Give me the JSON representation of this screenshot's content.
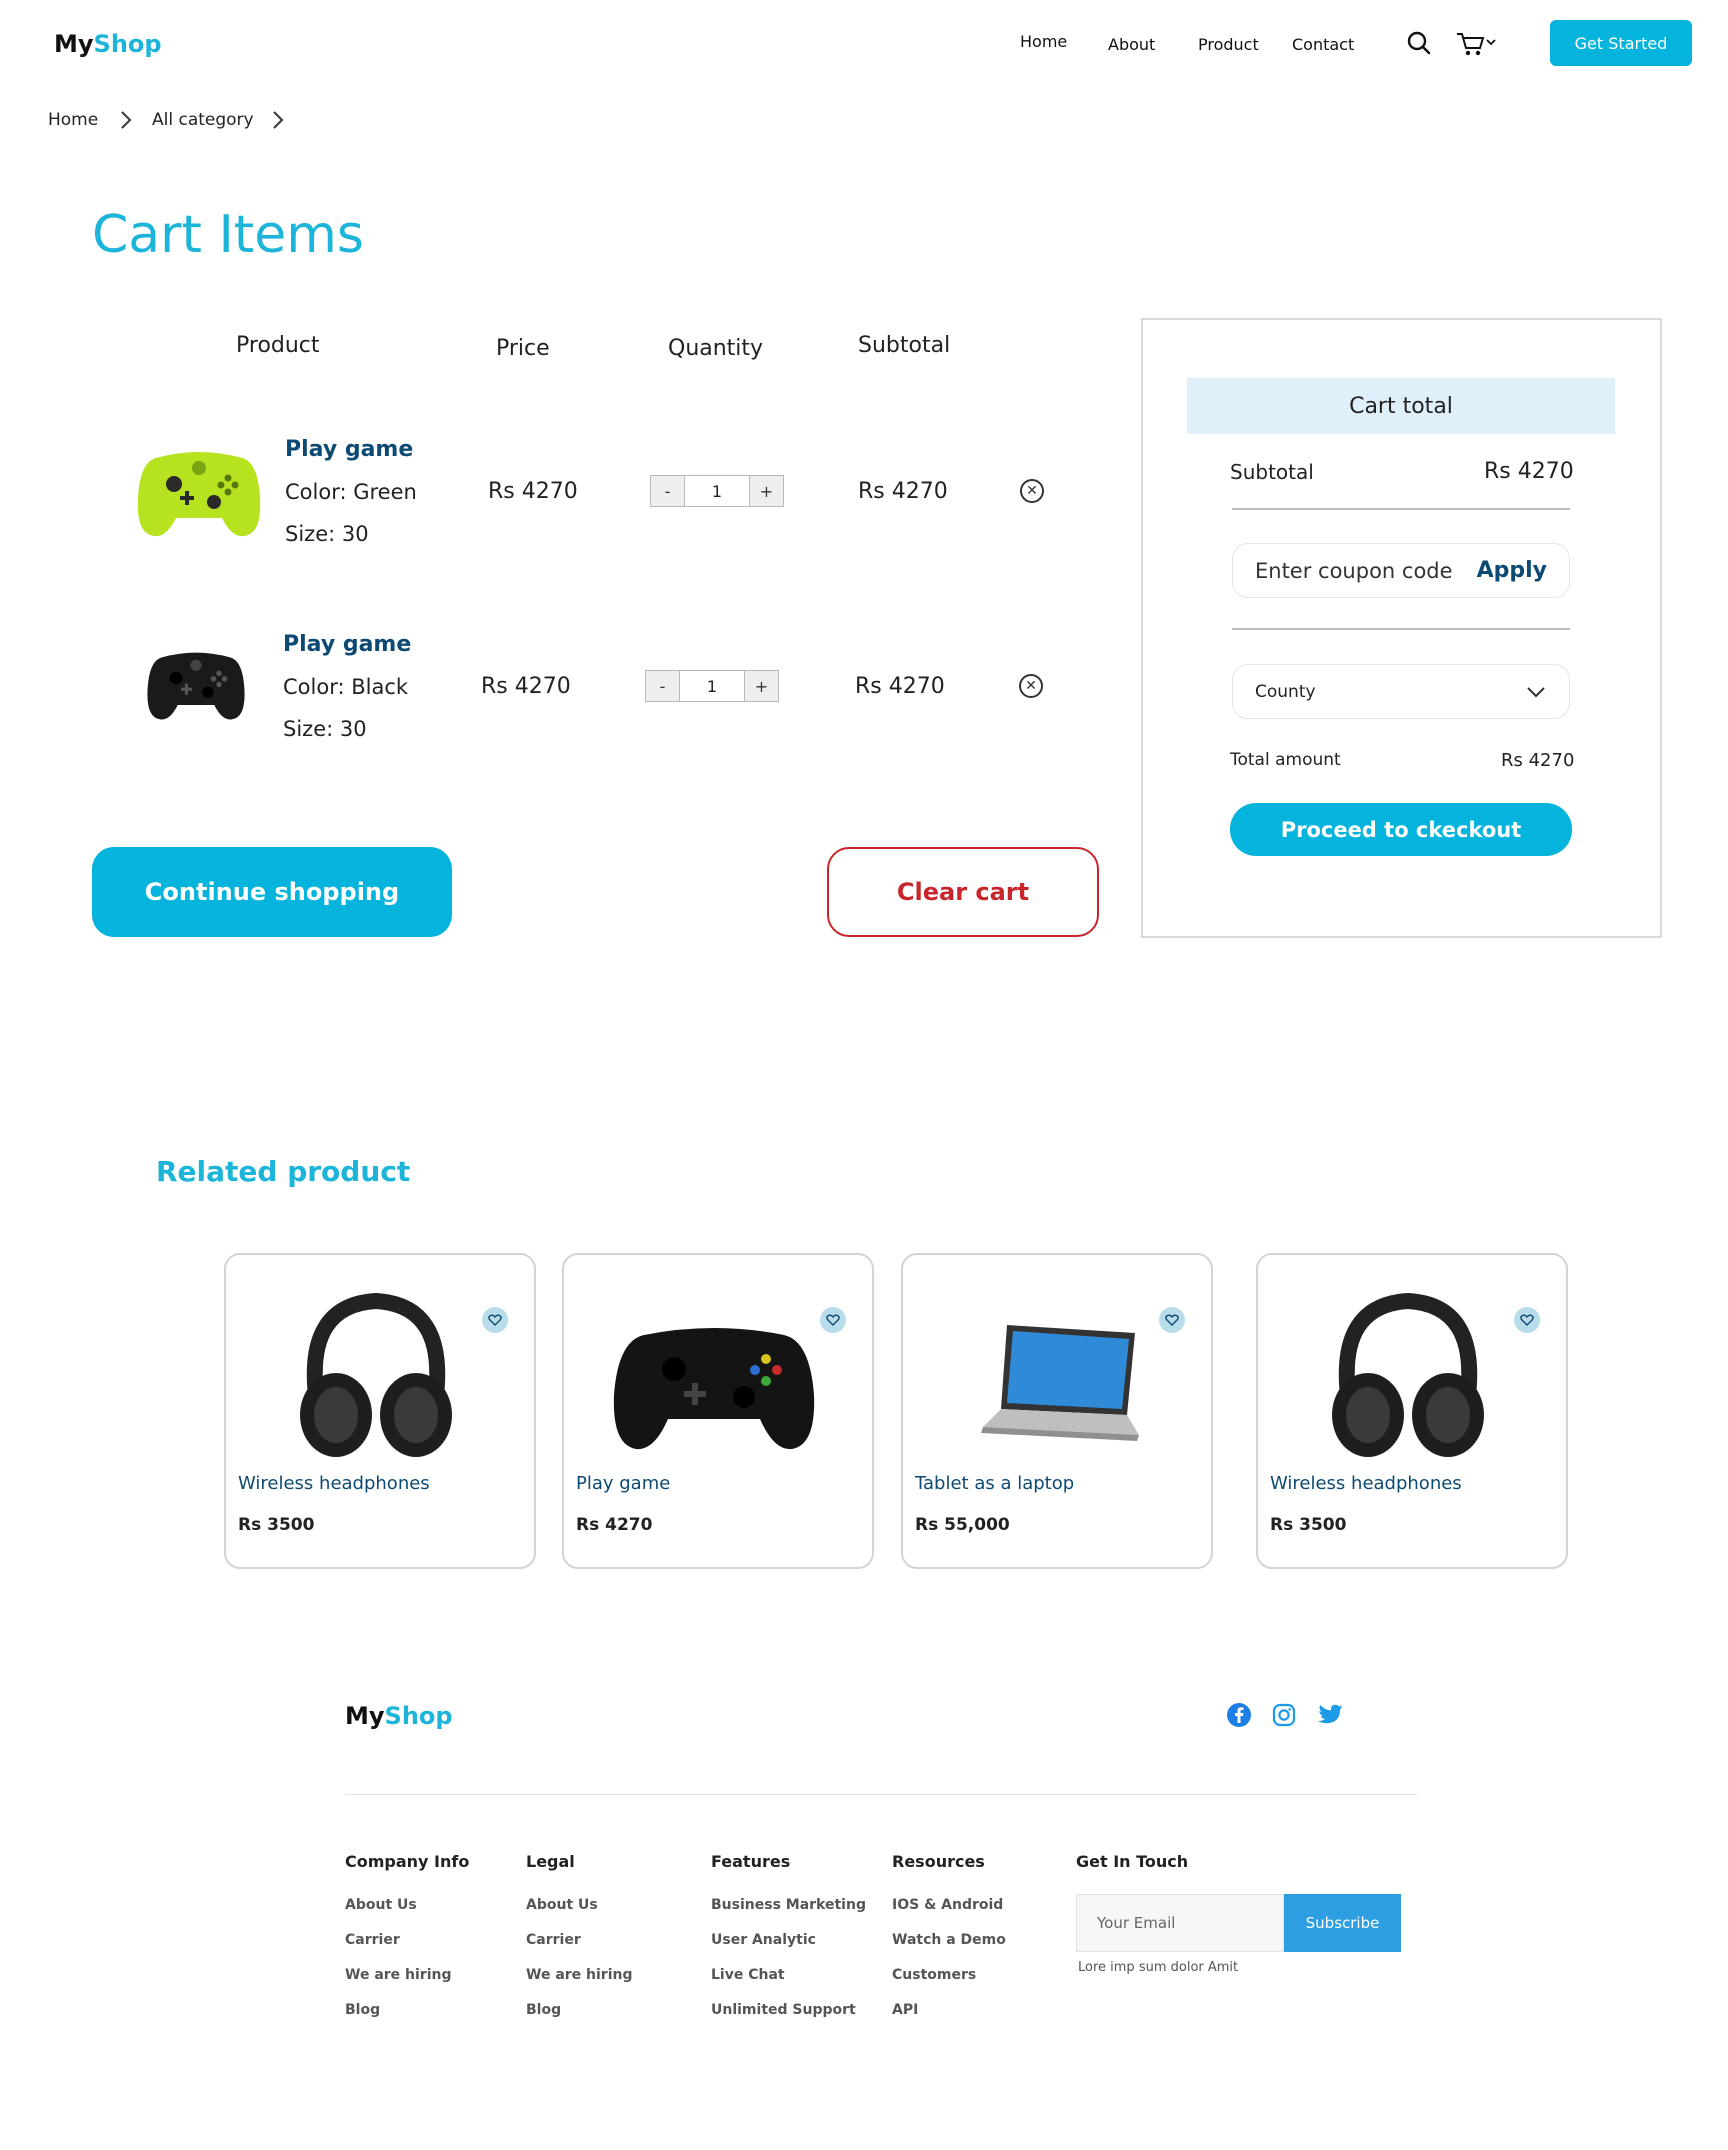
{
  "header": {
    "brand_a": "My",
    "brand_b": "Shop",
    "nav": [
      "Home",
      "About",
      "Product",
      "Contact"
    ],
    "cta": "Get Started"
  },
  "breadcrumb": [
    "Home",
    "All category"
  ],
  "title": "Cart Items",
  "table": {
    "headers": [
      "Product",
      "Price",
      "Quantity",
      "Subtotal"
    ]
  },
  "items": [
    {
      "name": "Play game",
      "color": "Color: Green",
      "size": "Size: 30",
      "price": "Rs 4270",
      "qty": "1",
      "minus": "-",
      "plus": "+",
      "subtotal": "Rs 4270",
      "image_color": "#b6e21f"
    },
    {
      "name": "Play game",
      "color": "Color: Black",
      "size": "Size: 30",
      "price": "Rs 4270",
      "qty": "1",
      "minus": "-",
      "plus": "+",
      "subtotal": "Rs 4270",
      "image_color": "#1a1a1a"
    }
  ],
  "buttons": {
    "continue": "Continue shopping",
    "clear": "Clear cart"
  },
  "summary": {
    "heading": "Cart total",
    "subtotal_label": "Subtotal",
    "subtotal_value": "Rs 4270",
    "coupon_placeholder": "Enter coupon code",
    "apply": "Apply",
    "country": "County",
    "total_label": "Total amount",
    "total_value": "Rs 4270",
    "checkout": "Proceed to ckeckout"
  },
  "related": {
    "heading": "Related product",
    "products": [
      {
        "name": "Wireless headphones",
        "price": "Rs 3500",
        "icon": "headphones-icon"
      },
      {
        "name": "Play game",
        "price": "Rs 4270",
        "icon": "controller-icon"
      },
      {
        "name": "Tablet as a laptop",
        "price": "Rs 55,000",
        "icon": "laptop-icon"
      },
      {
        "name": "Wireless headphones",
        "price": "Rs 3500",
        "icon": "headphones-icon"
      }
    ]
  },
  "footer": {
    "brand_a": "My",
    "brand_b": "Shop",
    "columns": [
      {
        "title": "Company Info",
        "links": [
          "About Us",
          "Carrier",
          "We are hiring",
          "Blog"
        ]
      },
      {
        "title": "Legal",
        "links": [
          "About Us",
          "Carrier",
          "We are hiring",
          "Blog"
        ]
      },
      {
        "title": "Features",
        "links": [
          "Business Marketing",
          "User Analytic",
          "Live Chat",
          "Unlimited Support"
        ]
      },
      {
        "title": "Resources",
        "links": [
          "IOS & Android",
          "Watch a Demo",
          "Customers",
          "API"
        ]
      }
    ],
    "contact": {
      "title": "Get In Touch",
      "email_placeholder": "Your Email",
      "subscribe": "Subscribe",
      "note": "Lore imp sum dolor Amit"
    }
  },
  "colors": {
    "accent": "#04b4dc",
    "danger": "#c9252c",
    "navy": "#0d4a73",
    "summary_head": "#dff0fb"
  }
}
